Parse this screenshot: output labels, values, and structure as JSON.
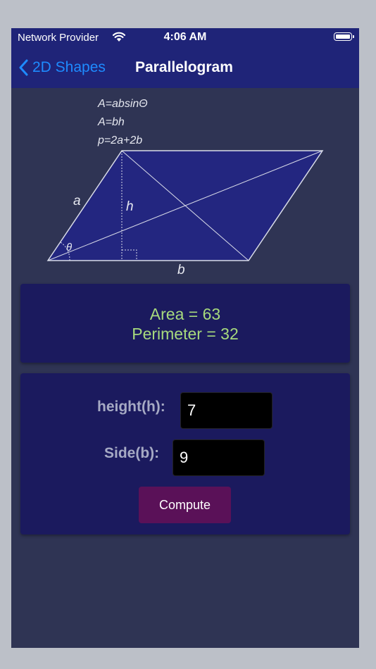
{
  "status_bar": {
    "carrier": "Network Provider",
    "time": "4:06 AM"
  },
  "nav": {
    "back_label": "2D Shapes",
    "title": "Parallelogram"
  },
  "diagram": {
    "formulas": [
      "A=absinΘ",
      "A=bh",
      "p=2a+2b"
    ],
    "label_a": "a",
    "label_h": "h",
    "label_b": "b",
    "label_theta": "θ"
  },
  "results": {
    "area": "Area = 63",
    "perimeter": "Perimeter = 32"
  },
  "form": {
    "height_label": "height(h):",
    "height_value": "7",
    "side_label": "Side(b):",
    "side_value": "9",
    "compute_label": "Compute"
  },
  "colors": {
    "nav_bg": "#1f2478",
    "screen_bg": "#2f3454",
    "card_bg": "#1b1a5e",
    "result_text": "#a7da7d",
    "back_blue": "#1e8bff",
    "button_bg": "#5a1158"
  }
}
